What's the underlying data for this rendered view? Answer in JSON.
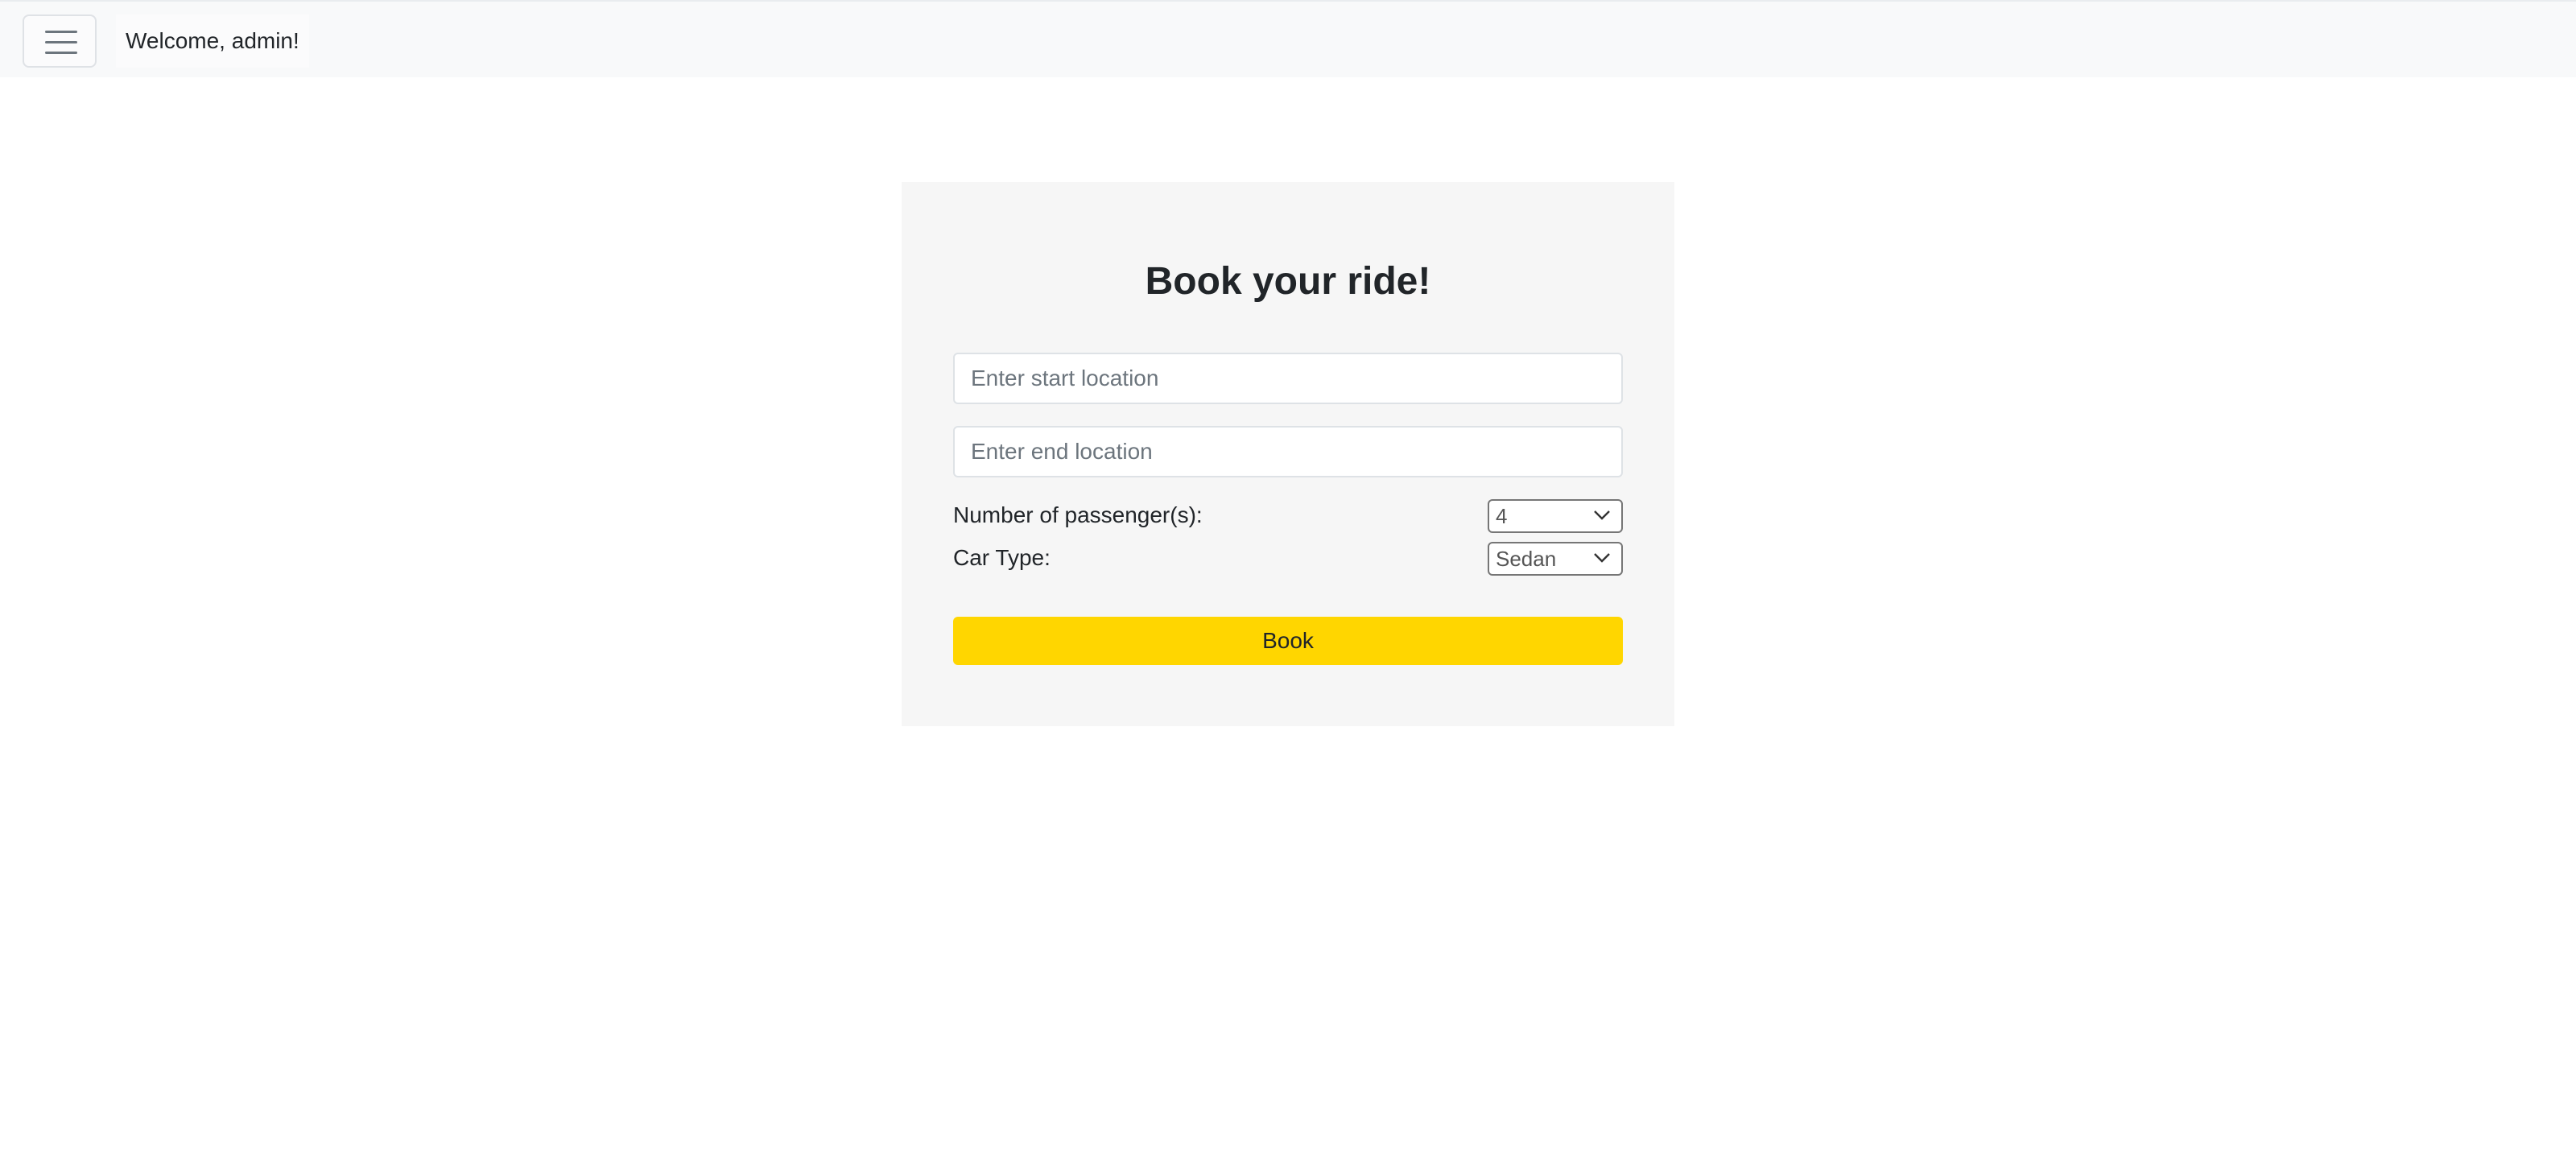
{
  "navbar": {
    "welcome_text": "Welcome, admin!",
    "menu_icon": "hamburger-menu-icon"
  },
  "form": {
    "title": "Book your ride!",
    "start_location": {
      "value": "",
      "placeholder": "Enter start location"
    },
    "end_location": {
      "value": "",
      "placeholder": "Enter end location"
    },
    "passengers": {
      "label": "Number of passenger(s):",
      "selected": "4"
    },
    "car_type": {
      "label": "Car Type:",
      "selected": "Sedan"
    },
    "book_label": "Book"
  },
  "colors": {
    "accent": "#ffd600",
    "navbar_bg": "#f8f9fa",
    "card_bg": "#f6f6f6"
  }
}
